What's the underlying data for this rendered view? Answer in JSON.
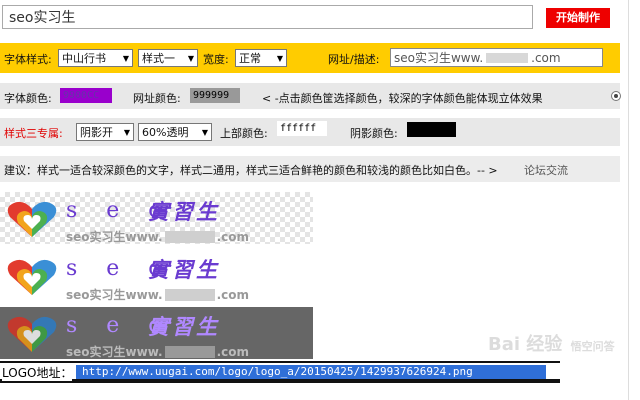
{
  "top": {
    "title_value": "seo实习生",
    "make_button": "开始制作"
  },
  "style_row": {
    "font_label": "字体样式:",
    "font_value": "中山行书",
    "style_value": "样式一",
    "width_label": "宽度:",
    "width_value": "正常",
    "url_label": "网址/描述:",
    "url_value_prefix": "seo实习生www.",
    "url_value_suffix": ".com"
  },
  "color_row": {
    "font_color_label": "字体颜色:",
    "font_color_value": "9900CC",
    "font_color_bg": "#9900cc",
    "url_color_label": "网址颜色:",
    "url_color_value": "999999",
    "url_color_bg": "#999999",
    "hint": "< -点击颜色筐选择颜色，较深的字体颜色能体现立体效果"
  },
  "third_row": {
    "label": "样式三专属:",
    "shadow_value": "阴影开",
    "opacity_value": "60%透明",
    "top_color_label": "上部颜色:",
    "top_color_value": "ffffff",
    "shadow_color_label": "阴影颜色:"
  },
  "tip_row": {
    "text": "建议：样式一适合较深颜色的文字，样式二通用，样式三适合鲜艳的颜色和较浅的颜色比如白色。-- >",
    "link": "论坛交流"
  },
  "preview": {
    "brand_latin": "s e o",
    "brand_cn": "實習生",
    "subline_prefix": "seo实习生www.",
    "subline_suffix": ".com"
  },
  "logo_bar": {
    "label": "LOGO地址：",
    "url": "http://www.uugai.com/logo/logo_a/20150425/1429937626924.png"
  },
  "watermark": {
    "main": "Bai 经验",
    "sub": "悟空问答"
  },
  "colors": {
    "accent_red": "#ee0000",
    "row_yellow": "#ffcc00",
    "brand_purple": "#6a3bd0"
  }
}
